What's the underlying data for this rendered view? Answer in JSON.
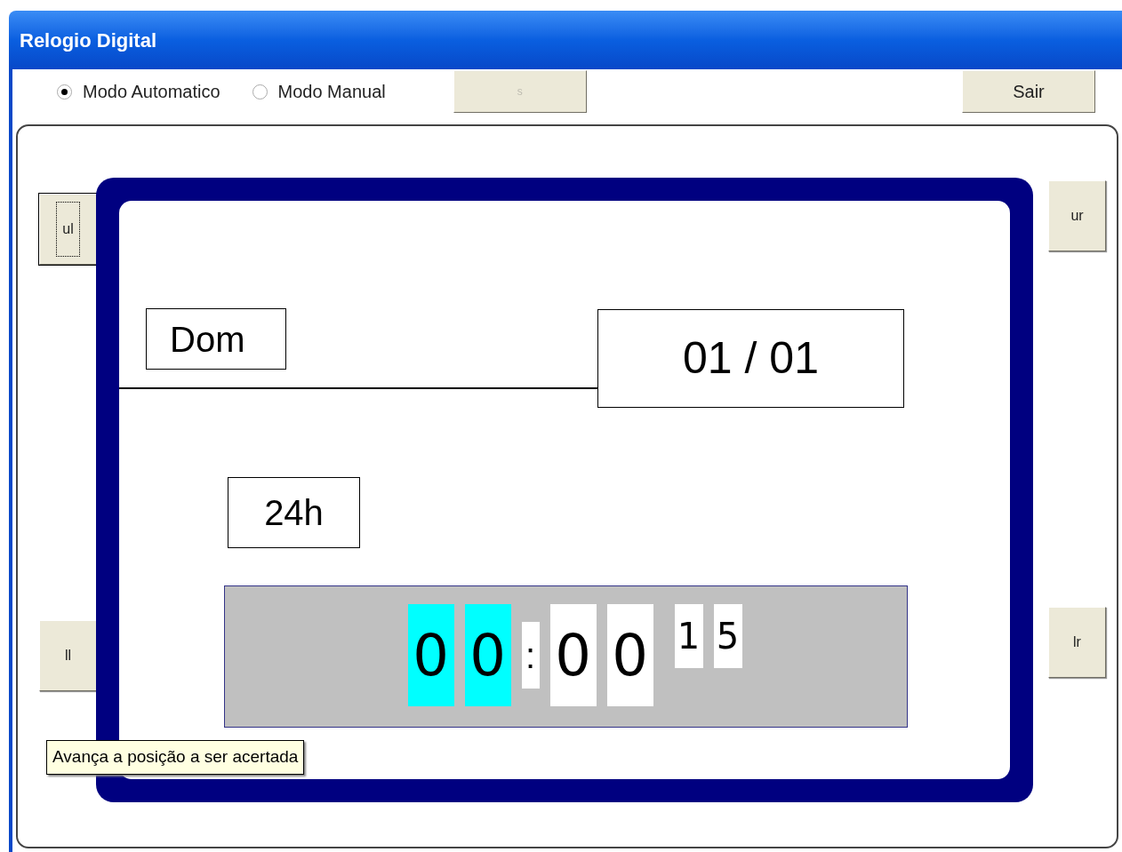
{
  "window": {
    "title": "Relogio Digital"
  },
  "modes": [
    {
      "label": "Modo Automatico",
      "selected": true
    },
    {
      "label": "Modo Manual",
      "selected": false
    }
  ],
  "toolbar_buttons": [
    {
      "label": "s",
      "disabled": true
    },
    {
      "label": "Sair",
      "disabled": false
    }
  ],
  "side_buttons": [
    {
      "label": "ul",
      "focused": true
    },
    {
      "label": "ur",
      "focused": false
    },
    {
      "label": "ll",
      "focused": false
    },
    {
      "label": "lr",
      "focused": false
    }
  ],
  "day": "Dom",
  "date": "01 / 01",
  "format": "24h",
  "clock": {
    "separator": ":",
    "digits": [
      {
        "text": "0",
        "kind": "large",
        "selected": true
      },
      {
        "text": "0",
        "kind": "large",
        "selected": true
      },
      {
        "text": "0",
        "kind": "large",
        "selected": false
      },
      {
        "text": "0",
        "kind": "large",
        "selected": false
      },
      {
        "text": "1",
        "kind": "small",
        "selected": false
      },
      {
        "text": "5",
        "kind": "small",
        "selected": false
      }
    ]
  },
  "tooltip": "Avança a posição a ser acertada"
}
